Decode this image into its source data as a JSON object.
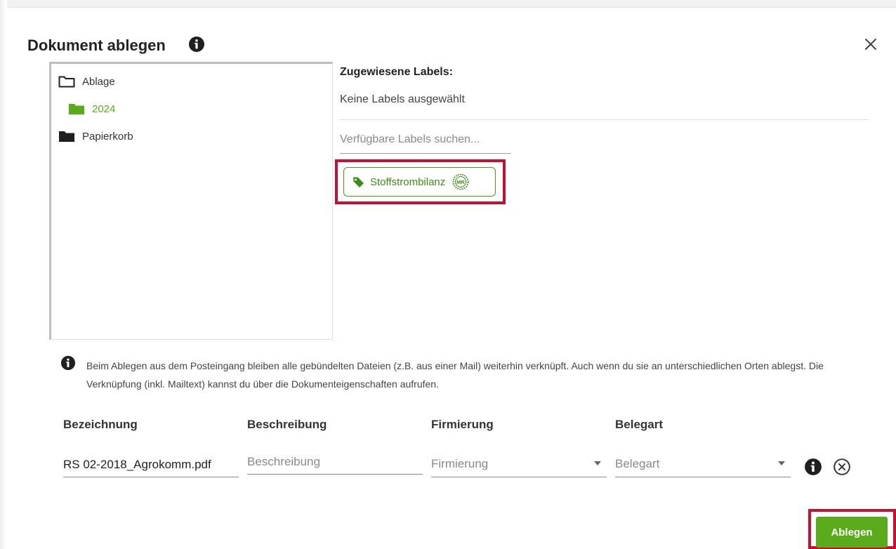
{
  "dialog": {
    "title": "Dokument ablegen",
    "close_icon": "close-icon",
    "info_icon": "info-circle-icon"
  },
  "tree": {
    "items": [
      {
        "label": "Ablage",
        "icon": "folder-outline-icon"
      },
      {
        "label": "2024",
        "icon": "folder-filled-icon",
        "color": "#5aab1b"
      },
      {
        "label": "Papierkorb",
        "icon": "folder-filled-icon"
      }
    ]
  },
  "labels": {
    "heading": "Zugewiesene Labels:",
    "none_text": "Keine Labels ausgewählt",
    "search_placeholder": "Verfügbare Labels suchen...",
    "chip": {
      "label": "Stoffstrombilanz",
      "badge": "MR",
      "icon": "tag-icon"
    }
  },
  "info_text": "Beim Ablegen aus dem Posteingang bleiben alle gebündelten Dateien (z.B. aus einer Mail) weiterhin verknüpft. Auch wenn du sie an unterschiedlichen Orten ablegst. Die Verknüpfung (inkl. Mailtext) kannst du über die Dokumenteigenschaften aufrufen.",
  "form": {
    "columns": [
      "Bezeichnung",
      "Beschreibung",
      "Firmierung",
      "Belegart"
    ],
    "bezeichnung_value": "RS 02-2018_Agrokomm.pdf",
    "beschreibung_placeholder": "Beschreibung",
    "firmierung_placeholder": "Firmierung",
    "belegart_placeholder": "Belegart"
  },
  "submit_label": "Ablegen",
  "colors": {
    "accent": "#5aab1b",
    "highlight": "#c8102e"
  }
}
